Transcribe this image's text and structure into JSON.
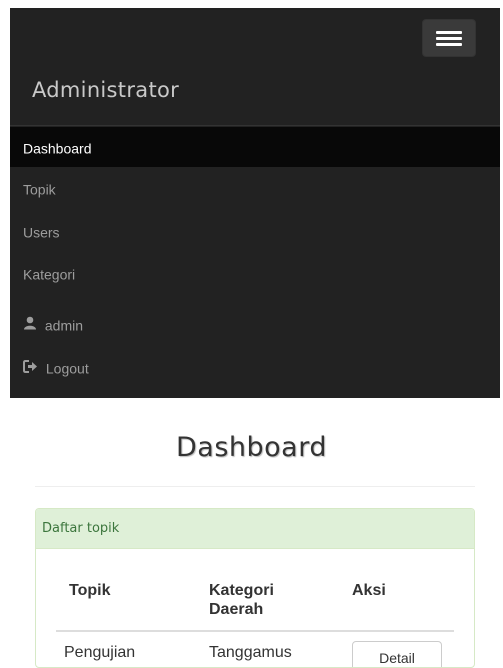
{
  "navbar": {
    "brand": "Administrator",
    "toggle_icon": "hamburger-icon",
    "items": [
      {
        "label": "Dashboard",
        "active": true
      },
      {
        "label": "Topik"
      },
      {
        "label": "Users"
      },
      {
        "label": "Kategori"
      },
      {
        "label": "admin",
        "icon": "user-icon"
      },
      {
        "label": "Logout",
        "icon": "logout-icon"
      }
    ]
  },
  "main": {
    "title": "Dashboard",
    "panel": {
      "heading": "Daftar topik",
      "columns": [
        "Topik",
        "Kategori Daerah",
        "Aksi"
      ],
      "rows": [
        {
          "topik": "Pengujian",
          "kategori": "Tanggamus",
          "aksi": "Detail"
        }
      ]
    }
  },
  "colors": {
    "navbar_bg": "#222222",
    "active_bg": "#080808",
    "panel_heading_bg": "#dff0d8",
    "panel_heading_text": "#3c763d"
  }
}
